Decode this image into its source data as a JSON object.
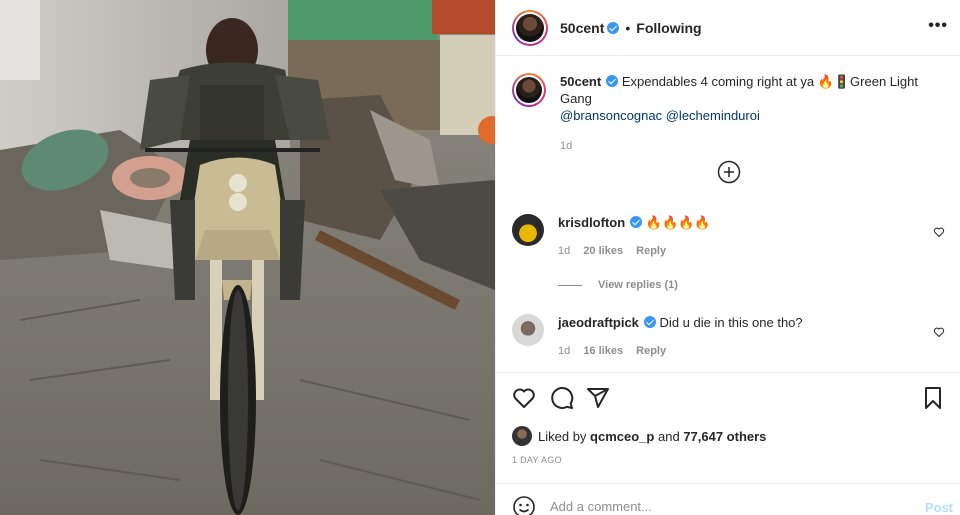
{
  "header": {
    "username": "50cent",
    "separator": "•",
    "following_label": "Following",
    "more_label": "•••"
  },
  "caption": {
    "username": "50cent",
    "text": "Expendables 4 coming right at ya 🔥🚦Green Light Gang",
    "mention_1": "@bransoncognac",
    "mention_2": "@lecheminduroi",
    "time": "1d"
  },
  "comments": [
    {
      "username": "krisdlofton",
      "text": "🔥🔥🔥🔥",
      "time": "1d",
      "likes": "20 likes",
      "reply_label": "Reply",
      "view_replies": "View replies (1)"
    },
    {
      "username": "jaeodraftpick",
      "text": "Did u die in this one tho?",
      "time": "1d",
      "likes": "16 likes",
      "reply_label": "Reply"
    }
  ],
  "likes": {
    "prefix": "Liked by",
    "user": "qcmceo_p",
    "and": "and",
    "others": "77,647 others"
  },
  "date": "1 DAY AGO",
  "add_comment": {
    "placeholder": "Add a comment...",
    "post_label": "Post",
    "post_color": "#b2dffc"
  },
  "colors": {
    "verified": "#3897f0",
    "mention": "#00376b",
    "muted": "#8e8e8e"
  },
  "icons": [
    "verified-icon",
    "more-icon",
    "add-icon",
    "heart-icon",
    "comment-icon",
    "share-icon",
    "save-icon",
    "emoji-icon"
  ]
}
